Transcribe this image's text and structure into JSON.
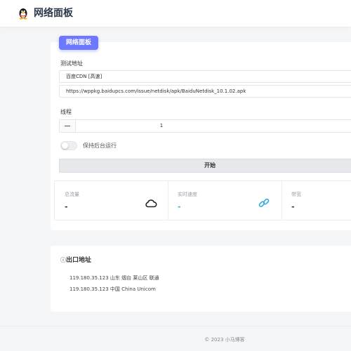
{
  "app": {
    "title": "网络面板"
  },
  "panel": {
    "tag": "网络面板",
    "url_label": "测试地址",
    "source_select": "百度CDN [高速]",
    "url_value": "https://wppkg.baidupcs.com/issue/netdisk/apk/BaiduNetdisk_10.1.02.apk",
    "thread_label": "线程",
    "thread_value": "1",
    "background_label": "保持后台运行",
    "start_label": "开始"
  },
  "stats": [
    {
      "label": "总流量",
      "value": "-",
      "icon": "cloud-icon"
    },
    {
      "label": "实时速度",
      "value": "-",
      "icon": "link-icon"
    },
    {
      "label": "带宽",
      "value": "-"
    }
  ],
  "ip": {
    "info_icon": "ⓘ",
    "title": "出口地址",
    "lines": [
      "119.180.35.123 山东 烟台 莱山区 联通",
      "119.180.35.123 中国 China Unicom"
    ]
  },
  "footer": {
    "text": "© 2023 小马博客"
  },
  "colors": {
    "accent": "#6b78ff",
    "speed": "#3aaed8"
  }
}
